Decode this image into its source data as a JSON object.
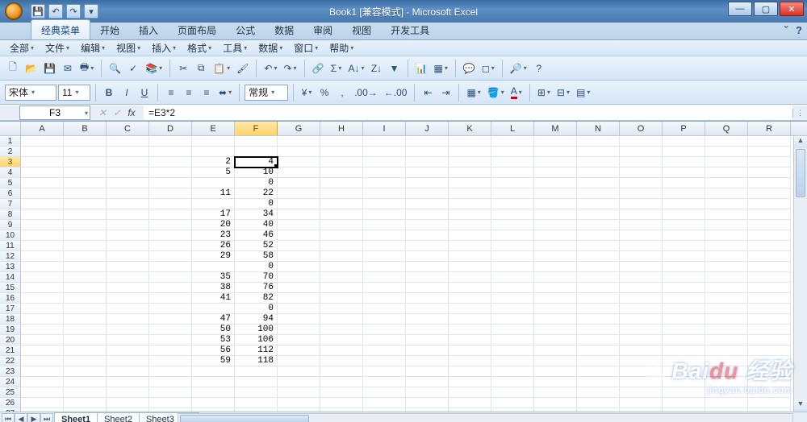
{
  "title": "Book1 [兼容模式] - Microsoft Excel",
  "qat_icons": [
    "save-icon",
    "undo-icon",
    "redo-icon",
    "print-icon"
  ],
  "win": {
    "min": "—",
    "max": "▢",
    "close": "✕"
  },
  "ribbon_tabs": [
    "经典菜单",
    "开始",
    "插入",
    "页面布局",
    "公式",
    "数据",
    "审阅",
    "视图",
    "开发工具"
  ],
  "ribbon_active_index": 0,
  "rib_help": {
    "minimize": "ˇ",
    "help": "?"
  },
  "menu_items": [
    "全部",
    "文件",
    "编辑",
    "视图",
    "插入",
    "格式",
    "工具",
    "数据",
    "窗口",
    "帮助"
  ],
  "toolbar1_first": [
    "new-icon",
    "open-icon",
    "save-icon",
    "mail-icon",
    "print-icon"
  ],
  "font": {
    "name": "宋体",
    "size": "11"
  },
  "style_btns": {
    "bold": "B",
    "italic": "I",
    "underline": "U"
  },
  "num_format": "常规",
  "name_box": "F3",
  "formula": "=E3*2",
  "columns": [
    "A",
    "B",
    "C",
    "D",
    "E",
    "F",
    "G",
    "H",
    "I",
    "J",
    "K",
    "L",
    "M",
    "N",
    "O",
    "P",
    "Q",
    "R"
  ],
  "selected_col": "F",
  "selected_row": 3,
  "row_count": 27,
  "cells": {
    "E": {
      "3": "2",
      "4": "5",
      "6": "11",
      "8": "17",
      "9": "20",
      "10": "23",
      "11": "26",
      "12": "29",
      "14": "35",
      "15": "38",
      "16": "41",
      "18": "47",
      "19": "50",
      "20": "53",
      "21": "56",
      "22": "59"
    },
    "F": {
      "3": "4",
      "4": "10",
      "5": "0",
      "6": "22",
      "7": "0",
      "8": "34",
      "9": "40",
      "10": "46",
      "11": "52",
      "12": "58",
      "13": "0",
      "14": "70",
      "15": "76",
      "16": "82",
      "17": "0",
      "18": "94",
      "19": "100",
      "20": "106",
      "21": "112",
      "22": "118"
    }
  },
  "sheet_tabs": [
    "Sheet1",
    "Sheet2",
    "Sheet3"
  ],
  "sheet_active_index": 0,
  "watermark": {
    "brand_a": "Bai",
    "brand_b": "du",
    "brand_c": "经验",
    "url": "jingyan.baidu.com"
  },
  "chart_data": {
    "type": "table",
    "columns": [
      "E",
      "F"
    ],
    "rows": [
      {
        "row": 3,
        "E": 2,
        "F": 4
      },
      {
        "row": 4,
        "E": 5,
        "F": 10
      },
      {
        "row": 5,
        "E": null,
        "F": 0
      },
      {
        "row": 6,
        "E": 11,
        "F": 22
      },
      {
        "row": 7,
        "E": null,
        "F": 0
      },
      {
        "row": 8,
        "E": 17,
        "F": 34
      },
      {
        "row": 9,
        "E": 20,
        "F": 40
      },
      {
        "row": 10,
        "E": 23,
        "F": 46
      },
      {
        "row": 11,
        "E": 26,
        "F": 52
      },
      {
        "row": 12,
        "E": 29,
        "F": 58
      },
      {
        "row": 13,
        "E": null,
        "F": 0
      },
      {
        "row": 14,
        "E": 35,
        "F": 70
      },
      {
        "row": 15,
        "E": 38,
        "F": 76
      },
      {
        "row": 16,
        "E": 41,
        "F": 82
      },
      {
        "row": 17,
        "E": null,
        "F": 0
      },
      {
        "row": 18,
        "E": 47,
        "F": 94
      },
      {
        "row": 19,
        "E": 50,
        "F": 100
      },
      {
        "row": 20,
        "E": 53,
        "F": 106
      },
      {
        "row": 21,
        "E": 56,
        "F": 112
      },
      {
        "row": 22,
        "E": 59,
        "F": 118
      }
    ],
    "formula_F": "=E*2"
  }
}
